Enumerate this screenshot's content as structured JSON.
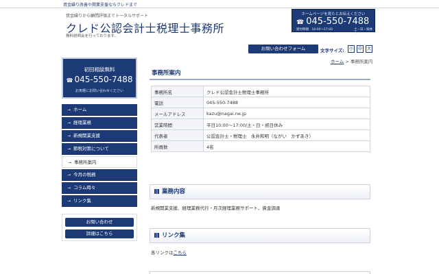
{
  "topbar": {
    "text": "資金繰り改善や開業支援ならクレドまで"
  },
  "header": {
    "subtitle": "資金繰りから顧問評価までトータルサポート",
    "title": "クレド公認会計士税理士事務所",
    "note": "無料説明会を行っております。"
  },
  "phone_box": {
    "label": "ホームページを見たとお伝えください",
    "number": "045-550-7488",
    "hours": "受付時間　10:00～17:00",
    "days": "土・日・祝休み"
  },
  "toolbar": {
    "contact_label": "お問い合わせフォーム",
    "fontsize_label": "文字サイズ:",
    "fontsize_options": [
      "小",
      "中",
      "大"
    ]
  },
  "sidebar_banner": {
    "title": "初回相談無料",
    "number": "045-550-7488",
    "sub": "お気軽にお問い合わせください"
  },
  "nav": {
    "items": [
      {
        "label": "ホーム"
      },
      {
        "label": "経理業務"
      },
      {
        "label": "新規開業支援"
      },
      {
        "label": "節税対策について"
      },
      {
        "label": "事務所案内"
      },
      {
        "label": "今月の税務"
      },
      {
        "label": "コラム時々"
      },
      {
        "label": "リンク集"
      }
    ],
    "active_index": 4
  },
  "side_buttons": {
    "contact": "お問い合わせ",
    "detail": "詳細はこちら"
  },
  "breadcrumb": {
    "home": "ホーム",
    "sep": " > ",
    "current": "事務所案内"
  },
  "main": {
    "title": "事務所案内",
    "table": [
      {
        "key": "事務所名",
        "value": "クレド公認会計士税理士事務所"
      },
      {
        "key": "電話",
        "value": "045-550-7488"
      },
      {
        "key": "メールアドレス",
        "value": "kazu@nagai.ne.jp"
      },
      {
        "key": "営業時間",
        "value": "平日10:00～17:00/土・日・祝日休み"
      },
      {
        "key": "代表者",
        "value": "公認会計士・税理士　永井和明（ながい　かずあき）"
      },
      {
        "key": "所員数",
        "value": "4名"
      }
    ],
    "services": {
      "title": "業務内容",
      "text": "新規開業支援、経理業務代行・月次経理業務サポート、資金調達"
    },
    "links": {
      "title": "リンク集",
      "prefix": "各リンクは",
      "link": "こちら"
    }
  },
  "colors": {
    "brand": "#1c3a75",
    "border": "#d0d6e0"
  },
  "icons": {
    "phone": "phone-icon",
    "arrow": "chevron-right-icon",
    "section": "grid-icon"
  }
}
